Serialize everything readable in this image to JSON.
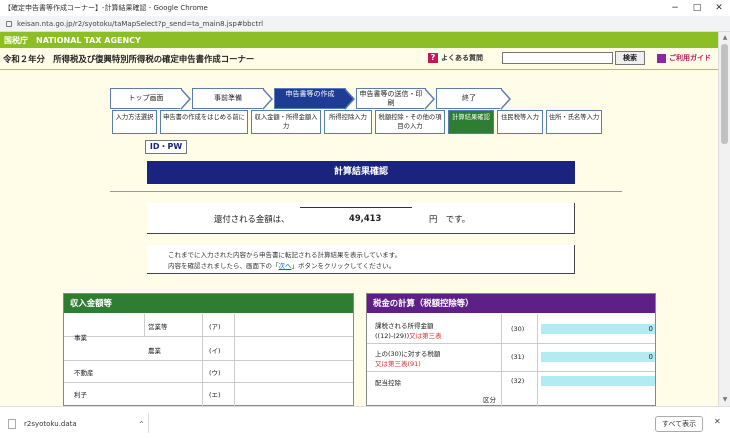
{
  "browser": {
    "title": "【確定申告書等作成コーナー】-計算結果確認 - Google Chrome",
    "url": "keisan.nta.go.jp/r2/syotoku/taMapSelect?p_send=ta_main8.jsp#bbctrl",
    "window_buttons": [
      "−",
      "□",
      "✕"
    ]
  },
  "agency": {
    "logo": "国税庁",
    "name": "NATIONAL TAX AGENCY"
  },
  "header": {
    "title": "令和２年分　所得税及び復興特別所得税の確定申告書作成コーナー",
    "faq_label": "よくある質問",
    "search_value": "",
    "search_button": "検索",
    "guide_label": "ご利用ガイド"
  },
  "steps_top": [
    {
      "label": "トップ画面"
    },
    {
      "label": "事前準備"
    },
    {
      "label": "申告書等の作成",
      "active": true
    },
    {
      "label": "申告書等の送信・印刷"
    },
    {
      "label": "終了"
    }
  ],
  "steps_sub": [
    {
      "label": "入力方法選択"
    },
    {
      "label": "申告書の作成をはじめる前に"
    },
    {
      "label": "収入金額・所得金額入力"
    },
    {
      "label": "所得控除入力"
    },
    {
      "label": "税額控除・その他の項目の入力"
    },
    {
      "label": "計算結果確認",
      "active": true
    },
    {
      "label": "住民税等入力"
    },
    {
      "label": "住所・氏名等入力"
    }
  ],
  "idpw_label": "ID・PW",
  "section_title": "計算結果確認",
  "refund": {
    "label": "還付される金額は、",
    "amount": "49,413",
    "unit": "円　です。"
  },
  "note": {
    "line1": "これまでに入力された内容から申告書に転記される計算結果を表示しています。",
    "line2_a": "内容を確認されましたら、画面下の「",
    "link": "次へ",
    "line2_b": "」ボタンをクリックしてください。"
  },
  "income_panel": {
    "title": "収入金額等",
    "rows": [
      {
        "group": "事業",
        "item": "営業等",
        "code": "(ア)"
      },
      {
        "group": "",
        "item": "農業",
        "code": "(イ)"
      },
      {
        "group": "不動産",
        "item": "",
        "code": "(ウ)"
      },
      {
        "group": "利子",
        "item": "",
        "code": "(エ)"
      }
    ]
  },
  "tax_panel": {
    "title": "税金の計算（税額控除等）",
    "rows": [
      {
        "label": "課税される所得金額",
        "label2": "((12)-(29))",
        "label2_red": "又は第三表",
        "num": "(30)",
        "value": "0"
      },
      {
        "label": "上の(30)に対する税額",
        "label2": "",
        "label2_red": "又は第三表(91)",
        "num": "(31)",
        "value": "0"
      },
      {
        "label": "配当控除",
        "label2": "",
        "label2_red": "",
        "num": "(32)",
        "value": ""
      }
    ],
    "extra": "区分"
  },
  "download": {
    "filename": "r2syotoku.data",
    "show_all": "すべて表示",
    "close": "✕"
  },
  "colors": {
    "agency_green": "#8cbf26",
    "nav_blue": "#1e3c96",
    "title_navy": "#1a237e",
    "income_green": "#2e7d32",
    "tax_purple": "#5e1f87",
    "page_bg": "#fffde7"
  }
}
